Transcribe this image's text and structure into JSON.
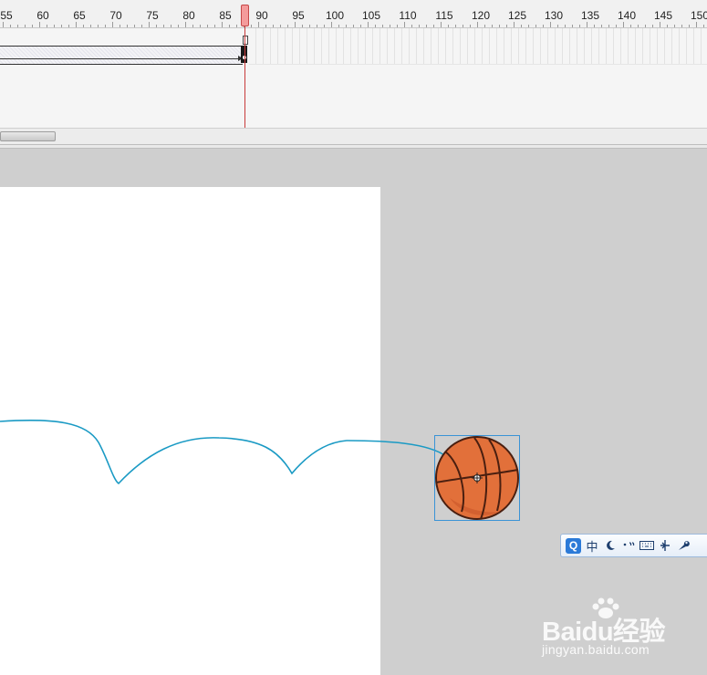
{
  "timeline": {
    "ruler_labels": [
      "55",
      "60",
      "65",
      "70",
      "75",
      "80",
      "85",
      "90",
      "95",
      "100",
      "105",
      "110",
      "115",
      "120",
      "125",
      "130",
      "135",
      "140",
      "145",
      "150"
    ],
    "current_frame": 88
  },
  "ime_toolbar": {
    "logo_text": "Q",
    "mode_text": "中",
    "icons": [
      "logo-q-icon",
      "chinese-mode-icon",
      "half-moon-icon",
      "punctuation-icon",
      "keyboard-icon",
      "skin-icon",
      "wrench-icon"
    ]
  },
  "watermark": {
    "brand": "Baidu经验",
    "url": "jingyan.baidu.com"
  },
  "colors": {
    "motion_path": "#1a9ac4",
    "selection_box": "#3a93d6",
    "ball": "#e2703a",
    "playhead": "#c83a3a"
  }
}
